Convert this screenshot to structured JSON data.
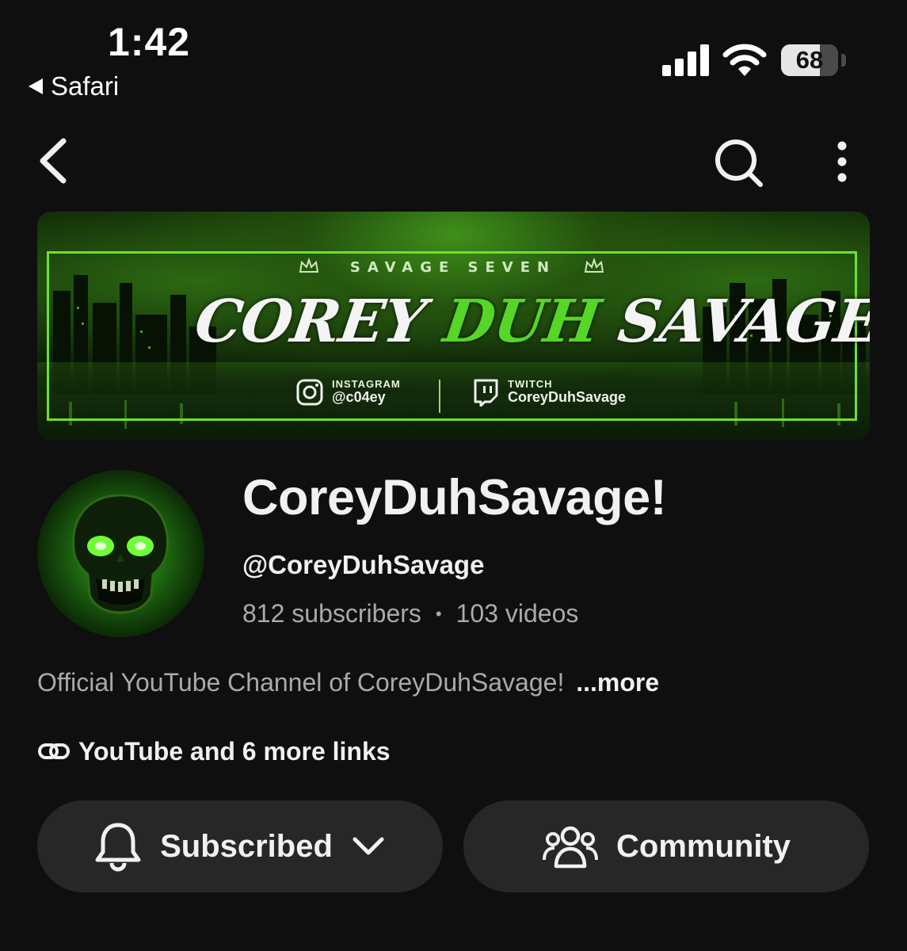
{
  "status_bar": {
    "time": "1:42",
    "back_app": "Safari",
    "battery": "68"
  },
  "nav": {
    "back_icon": "chevron-left-icon",
    "search_icon": "search-icon",
    "more_icon": "more-vert-icon"
  },
  "banner": {
    "tagline": "SAVAGE SEVEN",
    "title_part1": "COREY ",
    "title_part2": "DUH",
    "title_part3": " SAVAGE",
    "instagram_label": "INSTAGRAM",
    "instagram_handle": "@c04ey",
    "twitch_label": "TWITCH",
    "twitch_handle": "CoreyDuhSavage",
    "accent_color": "#56d626"
  },
  "channel": {
    "name": "CoreyDuhSavage!",
    "handle": "@CoreyDuhSavage",
    "subscribers": "812 subscribers",
    "separator": "•",
    "videos": "103 videos",
    "description": "Official YouTube Channel of CoreyDuhSavage!",
    "more_label": "...more",
    "links_label": "YouTube and 6 more links"
  },
  "actions": {
    "subscribed_label": "Subscribed",
    "community_label": "Community"
  }
}
